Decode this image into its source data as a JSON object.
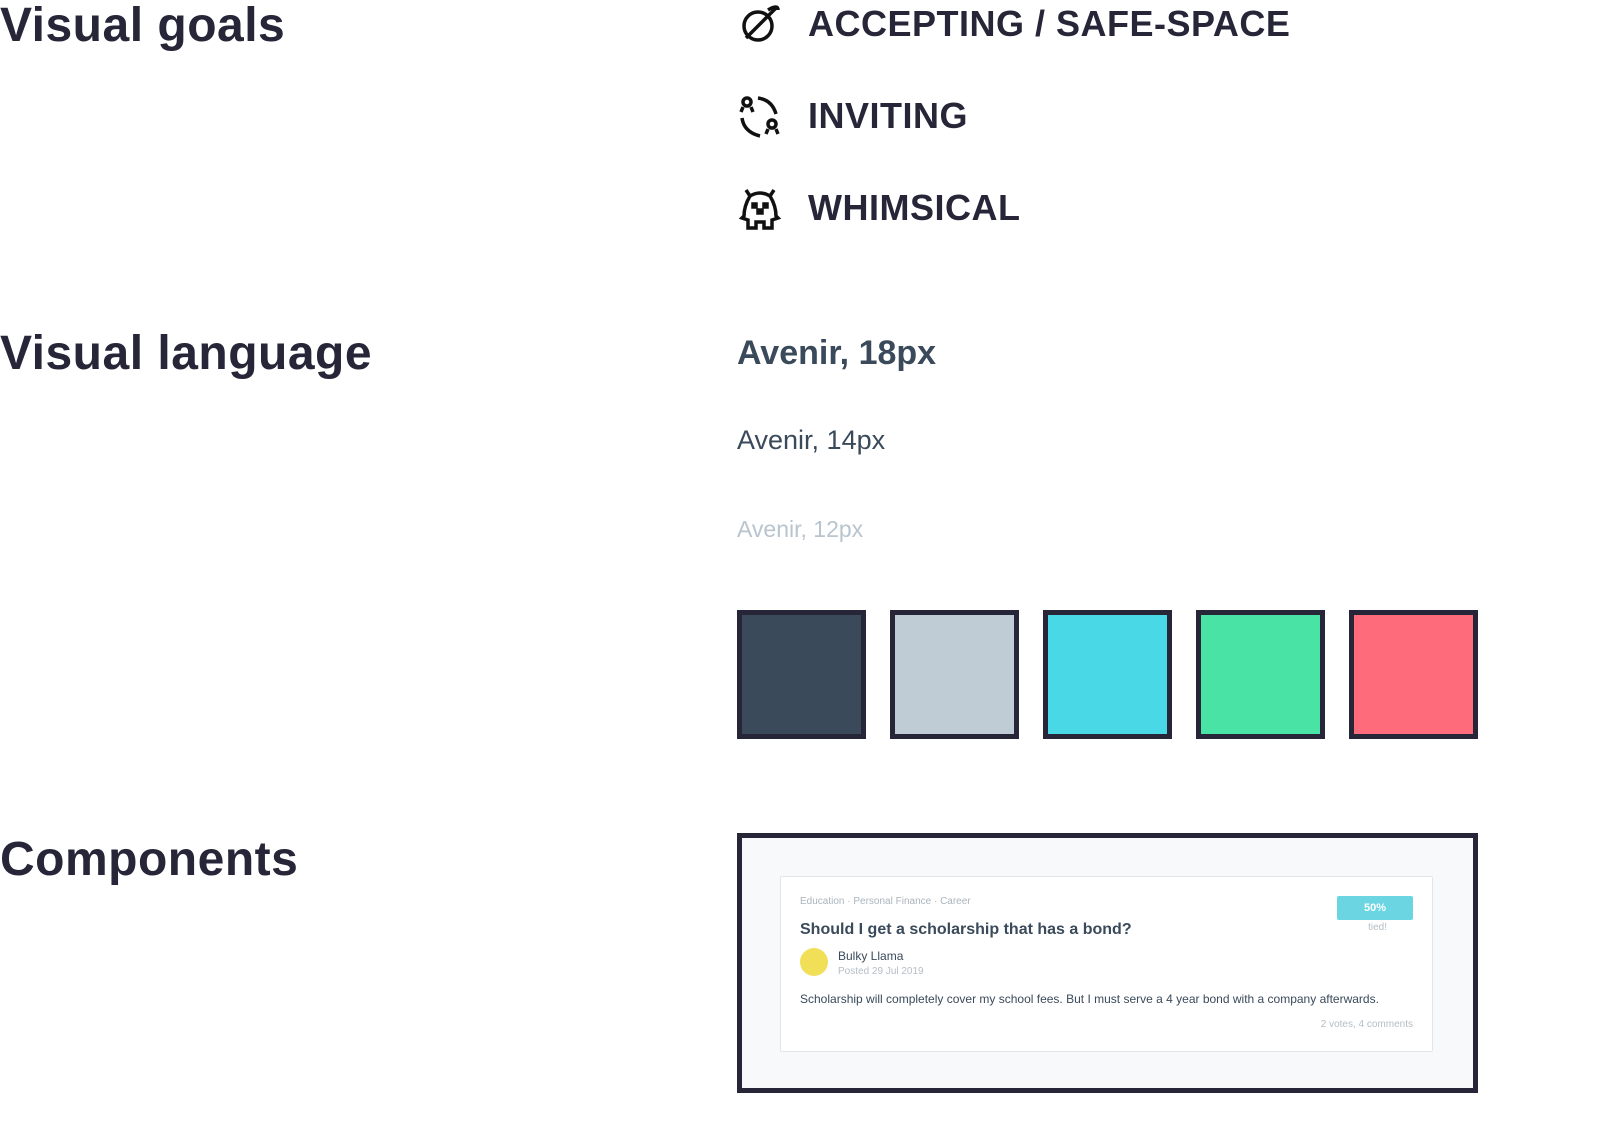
{
  "sections": {
    "goals": "Visual goals",
    "language": "Visual language",
    "components": "Components"
  },
  "goals": [
    {
      "icon": "planet-icon",
      "label": "ACCEPTING / SAFE-SPACE"
    },
    {
      "icon": "people-exchange-icon",
      "label": "INVITING"
    },
    {
      "icon": "monster-icon",
      "label": "WHIMSICAL"
    }
  ],
  "fonts": [
    "Avenir, 18px",
    "Avenir, 14px",
    "Avenir, 12px"
  ],
  "colors": [
    "#3a4a5a",
    "#c0ccd5",
    "#48d8e6",
    "#4ae3a6",
    "#fe6b7b"
  ],
  "card": {
    "tags": "Education · Personal Finance · Career",
    "title": "Should I get a scholarship that has a bond?",
    "author": "Bulky Llama",
    "posted": "Posted 29 Jul 2019",
    "body": "Scholarship will completely cover my school fees. But I must serve a 4 year bond with a company afterwards.",
    "meta": "2 votes, 4 comments",
    "percent": "50%",
    "status": "tied!"
  }
}
